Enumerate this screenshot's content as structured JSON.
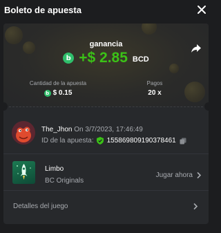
{
  "modal": {
    "title": "Boleto de apuesta"
  },
  "profit": {
    "label": "ganancia",
    "amount": "+$ 2.85",
    "currency": "BCD",
    "currency_icon": "bc-coin-icon",
    "accent_color": "#3bc117"
  },
  "stats": {
    "amount_label": "Cantidad de la apuesta",
    "amount_value": "$ 0.15",
    "payout_label": "Pagos",
    "payout_value": "20 x"
  },
  "bet": {
    "user": "The_Jhon",
    "date": "On 3/7/2023, 17:46:49",
    "id_label": "ID de la apuesta:",
    "id_value": "155869809190378461"
  },
  "game": {
    "name": "Limbo",
    "provider": "BC Originals",
    "play_label": "Jugar ahora"
  },
  "details_label": "Detalles del juego"
}
